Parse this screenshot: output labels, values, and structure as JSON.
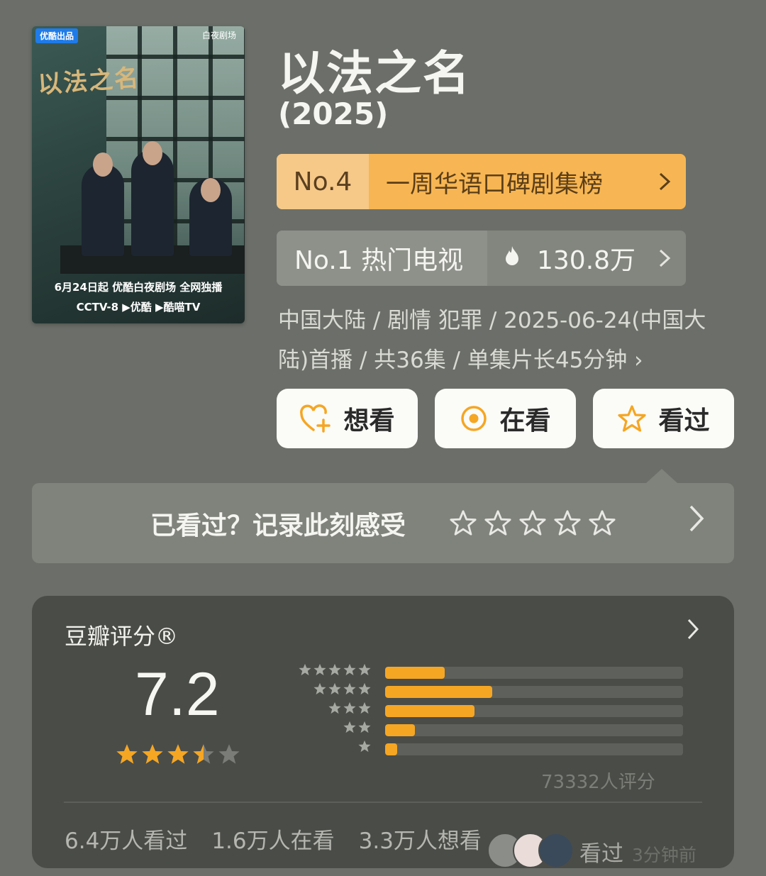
{
  "poster": {
    "badge": "优酷出品",
    "brand": "白夜剧场",
    "title_art": "以法之名",
    "date_line": "6月24日起 优酷白夜剧场 全网独播",
    "platforms_line": "CCTV-8 ▶优酷 ▶酷喵TV"
  },
  "show": {
    "title": "以法之名",
    "year": "(2025)"
  },
  "rank_weekly": {
    "no": "No.4",
    "label": "一周华语口碑剧集榜",
    "chevron": ">"
  },
  "rank_hot": {
    "no": "No.1 热门电视",
    "heat": "130.8万",
    "chevron": ">"
  },
  "meta": {
    "line": "中国大陆 / 剧情 犯罪 / 2025-06-24(中国大陆)首播 / 共36集 / 单集片长45分钟 ›"
  },
  "actions": {
    "want": "想看",
    "watching": "在看",
    "watched": "看过"
  },
  "record": {
    "prompt": "已看过？记录此刻感受",
    "chevron": "›"
  },
  "rating": {
    "title": "豆瓣评分®",
    "score": "7.2",
    "stars_value": 3.5,
    "count": "73332人评分",
    "distribution": [
      {
        "stars": 5,
        "fraction": 0.2
      },
      {
        "stars": 4,
        "fraction": 0.36
      },
      {
        "stars": 3,
        "fraction": 0.3
      },
      {
        "stars": 2,
        "fraction": 0.1
      },
      {
        "stars": 1,
        "fraction": 0.04
      }
    ],
    "stats": {
      "watched": "6.4万人看过",
      "watching": "1.6万人在看",
      "want": "3.3万人想看"
    },
    "recent": {
      "label": "看过",
      "time": "3分钟前"
    }
  },
  "colors": {
    "background": "#6c6f69",
    "accent_orange": "#f5a623",
    "rank_orange": "#f7b653",
    "card_dark": "#4a4c48"
  }
}
